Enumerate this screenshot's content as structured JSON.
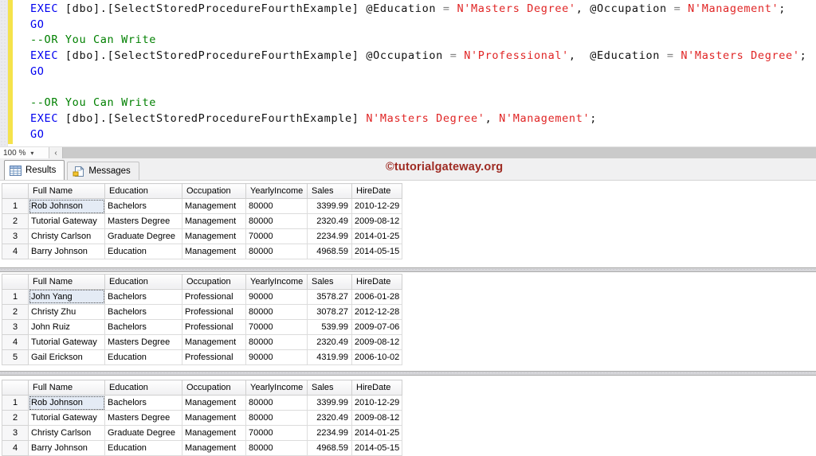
{
  "editor": {
    "zoom_level": "100 %",
    "scroll_left_glyph": "‹",
    "lines": [
      {
        "tokens": [
          {
            "c": "kw",
            "s": "EXEC"
          },
          {
            "c": "pl",
            "s": " [dbo].[SelectStoredProcedureFourthExample] @Education "
          },
          {
            "c": "op",
            "s": "="
          },
          {
            "c": "pl",
            "s": " "
          },
          {
            "c": "st",
            "s": "N'Masters Degree'"
          },
          {
            "c": "pl",
            "s": ", @Occupation "
          },
          {
            "c": "op",
            "s": "="
          },
          {
            "c": "pl",
            "s": " "
          },
          {
            "c": "st",
            "s": "N'Management'"
          },
          {
            "c": "pl",
            "s": ";"
          }
        ]
      },
      {
        "tokens": [
          {
            "c": "kw",
            "s": "GO"
          }
        ]
      },
      {
        "tokens": [
          {
            "c": "cm",
            "s": "--OR You Can Write"
          }
        ]
      },
      {
        "tokens": [
          {
            "c": "kw",
            "s": "EXEC"
          },
          {
            "c": "pl",
            "s": " [dbo].[SelectStoredProcedureFourthExample] @Occupation "
          },
          {
            "c": "op",
            "s": "="
          },
          {
            "c": "pl",
            "s": " "
          },
          {
            "c": "st",
            "s": "N'Professional'"
          },
          {
            "c": "pl",
            "s": ",  @Education "
          },
          {
            "c": "op",
            "s": "="
          },
          {
            "c": "pl",
            "s": " "
          },
          {
            "c": "st",
            "s": "N'Masters Degree'"
          },
          {
            "c": "pl",
            "s": ";"
          }
        ]
      },
      {
        "tokens": [
          {
            "c": "kw",
            "s": "GO"
          }
        ]
      },
      {
        "tokens": []
      },
      {
        "tokens": [
          {
            "c": "cm",
            "s": "--OR You Can Write"
          }
        ]
      },
      {
        "tokens": [
          {
            "c": "kw",
            "s": "EXEC"
          },
          {
            "c": "pl",
            "s": " [dbo].[SelectStoredProcedureFourthExample] "
          },
          {
            "c": "st",
            "s": "N'Masters Degree'"
          },
          {
            "c": "pl",
            "s": ", "
          },
          {
            "c": "st",
            "s": "N'Management'"
          },
          {
            "c": "pl",
            "s": ";"
          }
        ]
      },
      {
        "tokens": [
          {
            "c": "kw",
            "s": "GO"
          }
        ]
      }
    ]
  },
  "tabs": {
    "results": "Results",
    "messages": "Messages"
  },
  "watermark": "©tutorialgateway.org",
  "colors": {
    "keyword": "#0000f0",
    "string": "#e02525",
    "comment": "#008000",
    "operator": "#808080",
    "watermark": "#9e2a22",
    "change_bar": "#f5e34b"
  },
  "grids": [
    {
      "columns": [
        "Full Name",
        "Education",
        "Occupation",
        "YearlyIncome",
        "Sales",
        "HireDate"
      ],
      "rows": [
        [
          "1",
          "Rob Johnson",
          "Bachelors",
          "Management",
          "80000",
          "3399.99",
          "2010-12-29"
        ],
        [
          "2",
          "Tutorial Gateway",
          "Masters Degree",
          "Management",
          "80000",
          "2320.49",
          "2009-08-12"
        ],
        [
          "3",
          "Christy Carlson",
          "Graduate Degree",
          "Management",
          "70000",
          "2234.99",
          "2014-01-25"
        ],
        [
          "4",
          "Barry Johnson",
          "Education",
          "Management",
          "80000",
          "4968.59",
          "2014-05-15"
        ]
      ]
    },
    {
      "columns": [
        "Full Name",
        "Education",
        "Occupation",
        "YearlyIncome",
        "Sales",
        "HireDate"
      ],
      "rows": [
        [
          "1",
          "John Yang",
          "Bachelors",
          "Professional",
          "90000",
          "3578.27",
          "2006-01-28"
        ],
        [
          "2",
          "Christy Zhu",
          "Bachelors",
          "Professional",
          "80000",
          "3078.27",
          "2012-12-28"
        ],
        [
          "3",
          "John Ruiz",
          "Bachelors",
          "Professional",
          "70000",
          "539.99",
          "2009-07-06"
        ],
        [
          "4",
          "Tutorial Gateway",
          "Masters Degree",
          "Management",
          "80000",
          "2320.49",
          "2009-08-12"
        ],
        [
          "5",
          "Gail Erickson",
          "Education",
          "Professional",
          "90000",
          "4319.99",
          "2006-10-02"
        ]
      ]
    },
    {
      "columns": [
        "Full Name",
        "Education",
        "Occupation",
        "YearlyIncome",
        "Sales",
        "HireDate"
      ],
      "rows": [
        [
          "1",
          "Rob Johnson",
          "Bachelors",
          "Management",
          "80000",
          "3399.99",
          "2010-12-29"
        ],
        [
          "2",
          "Tutorial Gateway",
          "Masters Degree",
          "Management",
          "80000",
          "2320.49",
          "2009-08-12"
        ],
        [
          "3",
          "Christy Carlson",
          "Graduate Degree",
          "Management",
          "70000",
          "2234.99",
          "2014-01-25"
        ],
        [
          "4",
          "Barry Johnson",
          "Education",
          "Management",
          "80000",
          "4968.59",
          "2014-05-15"
        ]
      ]
    }
  ]
}
